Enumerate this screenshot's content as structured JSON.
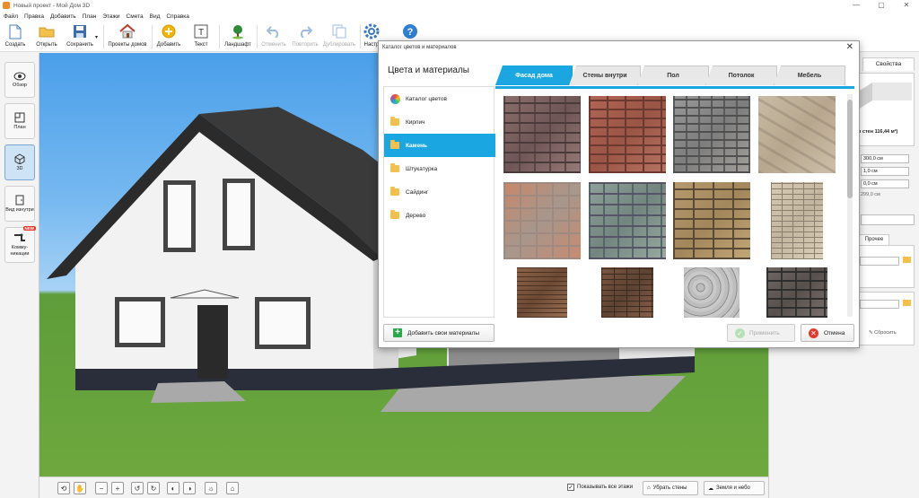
{
  "window": {
    "title": "Новый проект - Мой Дом 3D",
    "controls": [
      "—",
      "▢",
      "✕"
    ]
  },
  "menu": [
    "Файл",
    "Правка",
    "Добавить",
    "План",
    "Этажи",
    "Смета",
    "Вид",
    "Справка"
  ],
  "toolbar": {
    "create": "Создать",
    "open": "Открыть",
    "save": "Сохранить",
    "projects": "Проекты домов",
    "add": "Добавить",
    "text": "Текст",
    "landscape": "Ландшафт",
    "undo": "Отменить",
    "redo": "Повторить",
    "duplicate": "Дублировать",
    "settings": "Настр",
    "help": "?"
  },
  "left_panel": {
    "overview": "Обзор",
    "plan": "План",
    "view3d": "3D",
    "view_inside": "Вид изнутри",
    "comm": "Комму-никации",
    "new_badge": "NEW"
  },
  "bottom_bar": {
    "show_all_floors": "Показывать все этажи",
    "remove_walls": "Убрать стены",
    "earth_sky": "Земля и небо"
  },
  "right_panel": {
    "tab": "Свойства",
    "wall_info": "в стен 116,44 м²)",
    "field1": "300,0 см",
    "field2": "1,0 см",
    "field3": "0,0 см",
    "field4": "299,0 см",
    "tab2": "Прочее",
    "reset": "Сбросить"
  },
  "dialog": {
    "title": "Каталог цветов и материалов",
    "close": "✕",
    "heading": "Цвета и материалы",
    "categories": [
      {
        "label": "Каталог цветов",
        "icon": "palette-icon"
      },
      {
        "label": "Кирпич",
        "icon": "folder-icon"
      },
      {
        "label": "Камень",
        "icon": "folder-icon"
      },
      {
        "label": "Штукатурка",
        "icon": "folder-icon"
      },
      {
        "label": "Сайдинг",
        "icon": "folder-icon"
      },
      {
        "label": "Дерево",
        "icon": "folder-icon"
      }
    ],
    "active_category": "Камень",
    "tabs": [
      "Фасад дома",
      "Стены внутри",
      "Пол",
      "Потолок",
      "Мебель"
    ],
    "active_tab": "Фасад дома",
    "add_materials": "Добавить свои материалы",
    "apply": "Применить",
    "cancel": "Отмена"
  },
  "colors": {
    "accent": "#1aa6e0",
    "roof": "#2b2b2b",
    "wall": "#f2f2f2",
    "grass": "#6ea83e",
    "sky": "#4a9fea"
  }
}
